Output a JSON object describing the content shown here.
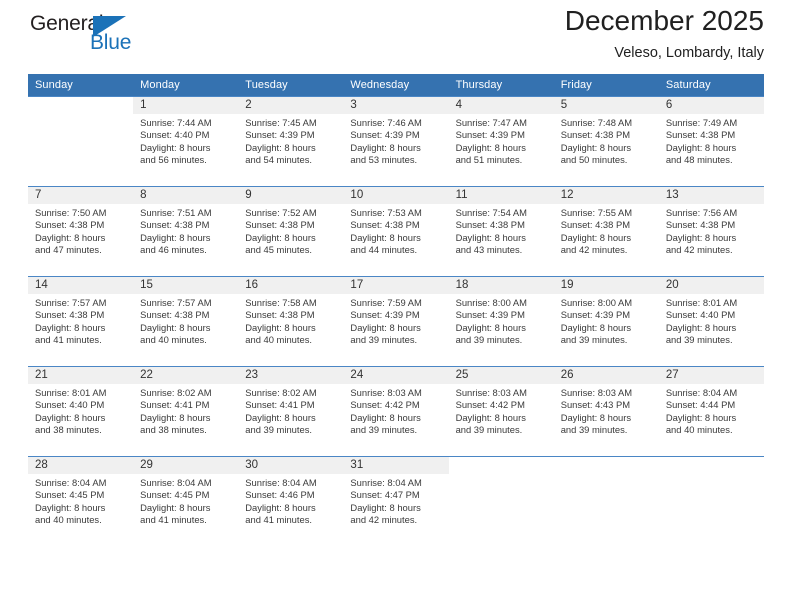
{
  "logo": {
    "word_top": "General",
    "word_bottom": "Blue",
    "accent_color": "#1b72b8"
  },
  "header": {
    "title": "December 2025",
    "subtitle": "Veleso, Lombardy, Italy"
  },
  "calendar": {
    "header_bg": "#3572b0",
    "weekday_headers": [
      "Sunday",
      "Monday",
      "Tuesday",
      "Wednesday",
      "Thursday",
      "Friday",
      "Saturday"
    ],
    "weeks": [
      [
        {
          "day": "",
          "lines": []
        },
        {
          "day": "1",
          "lines": [
            "Sunrise: 7:44 AM",
            "Sunset: 4:40 PM",
            "Daylight: 8 hours",
            "and 56 minutes."
          ]
        },
        {
          "day": "2",
          "lines": [
            "Sunrise: 7:45 AM",
            "Sunset: 4:39 PM",
            "Daylight: 8 hours",
            "and 54 minutes."
          ]
        },
        {
          "day": "3",
          "lines": [
            "Sunrise: 7:46 AM",
            "Sunset: 4:39 PM",
            "Daylight: 8 hours",
            "and 53 minutes."
          ]
        },
        {
          "day": "4",
          "lines": [
            "Sunrise: 7:47 AM",
            "Sunset: 4:39 PM",
            "Daylight: 8 hours",
            "and 51 minutes."
          ]
        },
        {
          "day": "5",
          "lines": [
            "Sunrise: 7:48 AM",
            "Sunset: 4:38 PM",
            "Daylight: 8 hours",
            "and 50 minutes."
          ]
        },
        {
          "day": "6",
          "lines": [
            "Sunrise: 7:49 AM",
            "Sunset: 4:38 PM",
            "Daylight: 8 hours",
            "and 48 minutes."
          ]
        }
      ],
      [
        {
          "day": "7",
          "lines": [
            "Sunrise: 7:50 AM",
            "Sunset: 4:38 PM",
            "Daylight: 8 hours",
            "and 47 minutes."
          ]
        },
        {
          "day": "8",
          "lines": [
            "Sunrise: 7:51 AM",
            "Sunset: 4:38 PM",
            "Daylight: 8 hours",
            "and 46 minutes."
          ]
        },
        {
          "day": "9",
          "lines": [
            "Sunrise: 7:52 AM",
            "Sunset: 4:38 PM",
            "Daylight: 8 hours",
            "and 45 minutes."
          ]
        },
        {
          "day": "10",
          "lines": [
            "Sunrise: 7:53 AM",
            "Sunset: 4:38 PM",
            "Daylight: 8 hours",
            "and 44 minutes."
          ]
        },
        {
          "day": "11",
          "lines": [
            "Sunrise: 7:54 AM",
            "Sunset: 4:38 PM",
            "Daylight: 8 hours",
            "and 43 minutes."
          ]
        },
        {
          "day": "12",
          "lines": [
            "Sunrise: 7:55 AM",
            "Sunset: 4:38 PM",
            "Daylight: 8 hours",
            "and 42 minutes."
          ]
        },
        {
          "day": "13",
          "lines": [
            "Sunrise: 7:56 AM",
            "Sunset: 4:38 PM",
            "Daylight: 8 hours",
            "and 42 minutes."
          ]
        }
      ],
      [
        {
          "day": "14",
          "lines": [
            "Sunrise: 7:57 AM",
            "Sunset: 4:38 PM",
            "Daylight: 8 hours",
            "and 41 minutes."
          ]
        },
        {
          "day": "15",
          "lines": [
            "Sunrise: 7:57 AM",
            "Sunset: 4:38 PM",
            "Daylight: 8 hours",
            "and 40 minutes."
          ]
        },
        {
          "day": "16",
          "lines": [
            "Sunrise: 7:58 AM",
            "Sunset: 4:38 PM",
            "Daylight: 8 hours",
            "and 40 minutes."
          ]
        },
        {
          "day": "17",
          "lines": [
            "Sunrise: 7:59 AM",
            "Sunset: 4:39 PM",
            "Daylight: 8 hours",
            "and 39 minutes."
          ]
        },
        {
          "day": "18",
          "lines": [
            "Sunrise: 8:00 AM",
            "Sunset: 4:39 PM",
            "Daylight: 8 hours",
            "and 39 minutes."
          ]
        },
        {
          "day": "19",
          "lines": [
            "Sunrise: 8:00 AM",
            "Sunset: 4:39 PM",
            "Daylight: 8 hours",
            "and 39 minutes."
          ]
        },
        {
          "day": "20",
          "lines": [
            "Sunrise: 8:01 AM",
            "Sunset: 4:40 PM",
            "Daylight: 8 hours",
            "and 39 minutes."
          ]
        }
      ],
      [
        {
          "day": "21",
          "lines": [
            "Sunrise: 8:01 AM",
            "Sunset: 4:40 PM",
            "Daylight: 8 hours",
            "and 38 minutes."
          ]
        },
        {
          "day": "22",
          "lines": [
            "Sunrise: 8:02 AM",
            "Sunset: 4:41 PM",
            "Daylight: 8 hours",
            "and 38 minutes."
          ]
        },
        {
          "day": "23",
          "lines": [
            "Sunrise: 8:02 AM",
            "Sunset: 4:41 PM",
            "Daylight: 8 hours",
            "and 39 minutes."
          ]
        },
        {
          "day": "24",
          "lines": [
            "Sunrise: 8:03 AM",
            "Sunset: 4:42 PM",
            "Daylight: 8 hours",
            "and 39 minutes."
          ]
        },
        {
          "day": "25",
          "lines": [
            "Sunrise: 8:03 AM",
            "Sunset: 4:42 PM",
            "Daylight: 8 hours",
            "and 39 minutes."
          ]
        },
        {
          "day": "26",
          "lines": [
            "Sunrise: 8:03 AM",
            "Sunset: 4:43 PM",
            "Daylight: 8 hours",
            "and 39 minutes."
          ]
        },
        {
          "day": "27",
          "lines": [
            "Sunrise: 8:04 AM",
            "Sunset: 4:44 PM",
            "Daylight: 8 hours",
            "and 40 minutes."
          ]
        }
      ],
      [
        {
          "day": "28",
          "lines": [
            "Sunrise: 8:04 AM",
            "Sunset: 4:45 PM",
            "Daylight: 8 hours",
            "and 40 minutes."
          ]
        },
        {
          "day": "29",
          "lines": [
            "Sunrise: 8:04 AM",
            "Sunset: 4:45 PM",
            "Daylight: 8 hours",
            "and 41 minutes."
          ]
        },
        {
          "day": "30",
          "lines": [
            "Sunrise: 8:04 AM",
            "Sunset: 4:46 PM",
            "Daylight: 8 hours",
            "and 41 minutes."
          ]
        },
        {
          "day": "31",
          "lines": [
            "Sunrise: 8:04 AM",
            "Sunset: 4:47 PM",
            "Daylight: 8 hours",
            "and 42 minutes."
          ]
        },
        {
          "day": "",
          "lines": []
        },
        {
          "day": "",
          "lines": []
        },
        {
          "day": "",
          "lines": []
        }
      ]
    ]
  }
}
